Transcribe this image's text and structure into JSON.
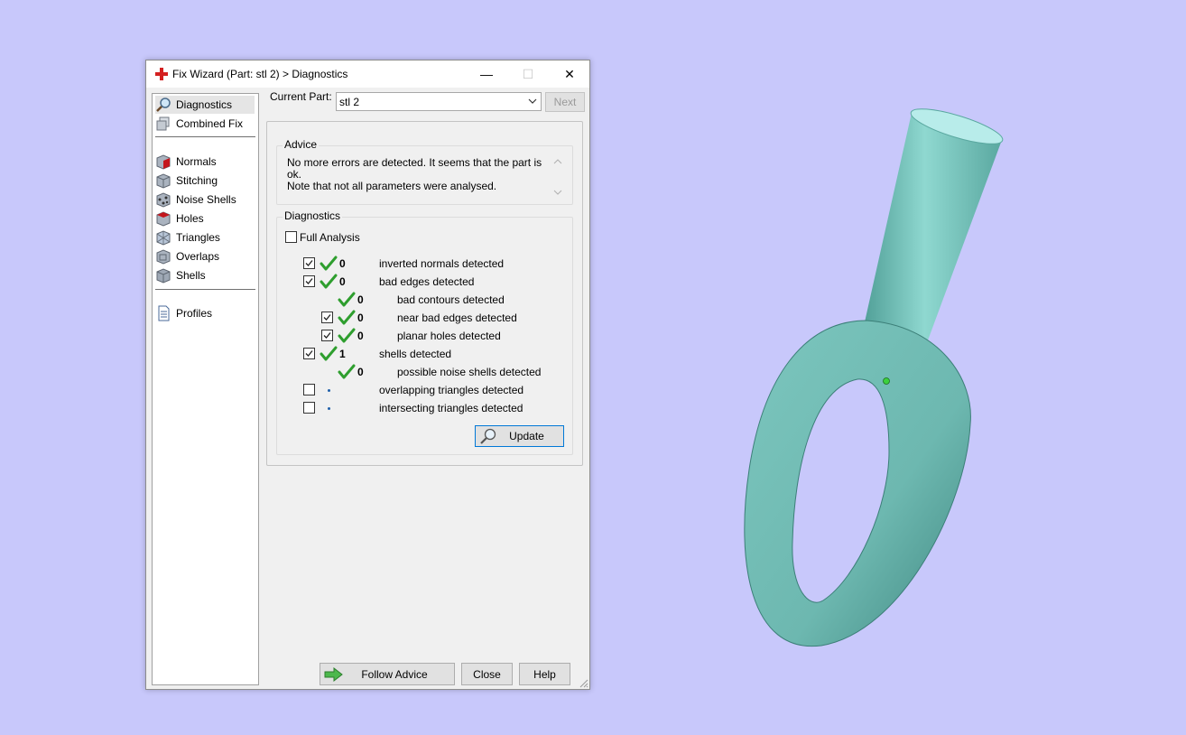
{
  "window": {
    "title": "Fix Wizard (Part: stl 2) > Diagnostics",
    "controls": {
      "minimize": "—",
      "maximize": "☐",
      "close": "✕"
    }
  },
  "sidebar": {
    "items": [
      {
        "label": "Diagnostics",
        "icon": "magnifier-icon",
        "selected": true
      },
      {
        "label": "Combined Fix",
        "icon": "cube-stack-icon"
      },
      {
        "label": "Normals",
        "icon": "cube-normals-icon"
      },
      {
        "label": "Stitching",
        "icon": "cube-stitching-icon"
      },
      {
        "label": "Noise Shells",
        "icon": "cube-noise-icon"
      },
      {
        "label": "Holes",
        "icon": "cube-holes-icon"
      },
      {
        "label": "Triangles",
        "icon": "cube-triangles-icon"
      },
      {
        "label": "Overlaps",
        "icon": "cube-overlaps-icon"
      },
      {
        "label": "Shells",
        "icon": "cube-shells-icon"
      },
      {
        "label": "Profiles",
        "icon": "document-icon"
      }
    ]
  },
  "current_part": {
    "label": "Current Part:",
    "value": "stl 2",
    "next_label": "Next"
  },
  "advice": {
    "title": "Advice",
    "text_line1": "No more errors are detected. It seems that the part is ok.",
    "text_line2": "Note that not all parameters were analysed."
  },
  "diagnostics": {
    "title": "Diagnostics",
    "full_analysis_label": "Full Analysis",
    "full_analysis_checked": false,
    "rows": [
      {
        "text": "inverted normals detected",
        "count": "0",
        "checked": true,
        "ok": true,
        "indent": 0
      },
      {
        "text": "bad edges detected",
        "count": "0",
        "checked": true,
        "ok": true,
        "indent": 0
      },
      {
        "text": "bad contours detected",
        "count": "0",
        "checked": null,
        "ok": true,
        "indent": 1
      },
      {
        "text": "near bad edges detected",
        "count": "0",
        "checked": true,
        "ok": true,
        "indent": 1
      },
      {
        "text": "planar holes detected",
        "count": "0",
        "checked": true,
        "ok": true,
        "indent": 1
      },
      {
        "text": "shells detected",
        "count": "1",
        "checked": true,
        "ok": true,
        "indent": 0
      },
      {
        "text": "possible noise shells detected",
        "count": "0",
        "checked": null,
        "ok": true,
        "indent": 1
      },
      {
        "text": "overlapping triangles detected",
        "count": "",
        "checked": false,
        "ok": false,
        "indent": 0
      },
      {
        "text": "intersecting triangles detected",
        "count": "",
        "checked": false,
        "ok": false,
        "indent": 0
      }
    ],
    "update_label": "Update"
  },
  "footer": {
    "follow_advice_label": "Follow Advice",
    "close_label": "Close",
    "help_label": "Help"
  },
  "colors": {
    "desktop": "#c8c8fb",
    "model_fill": "#86cdc6",
    "check_green": "#2e9e2e",
    "title_icon_red": "#d42020"
  }
}
